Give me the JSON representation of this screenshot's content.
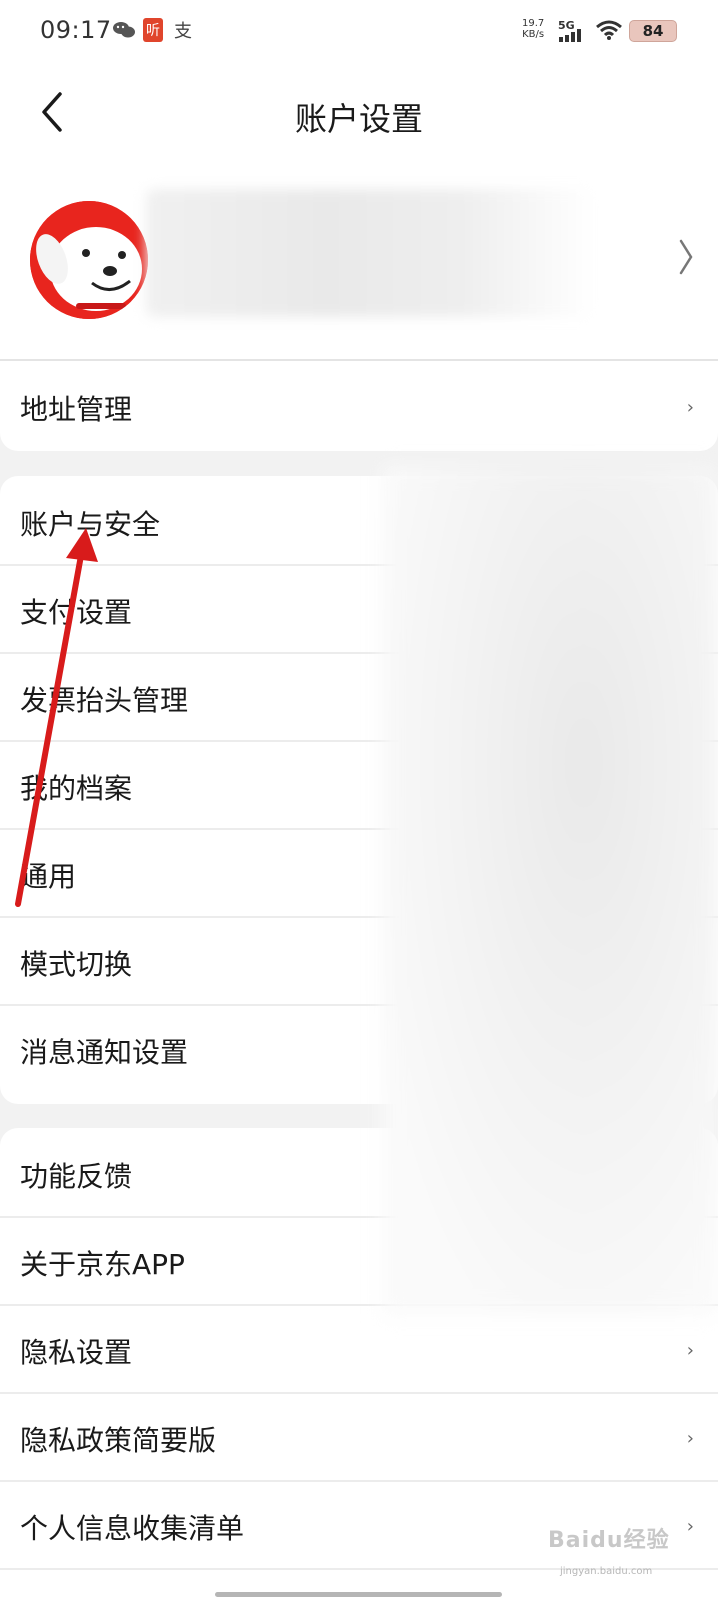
{
  "status_bar": {
    "time": "09:17",
    "wechat_icon": "wechat-icon",
    "app_badge_glyph": "听",
    "alipay_glyph": "支",
    "speed_value": "19.7",
    "speed_unit": "KB/s",
    "network": "5G",
    "battery": "84"
  },
  "header": {
    "title": "账户设置"
  },
  "profile": {
    "avatar": "jd-dog-mascot"
  },
  "groups": [
    {
      "items": [
        {
          "label": "地址管理"
        }
      ]
    },
    {
      "items": [
        {
          "label": "账户与安全"
        },
        {
          "label": "支付设置"
        },
        {
          "label": "发票抬头管理"
        },
        {
          "label": "我的档案"
        },
        {
          "label": "通用"
        },
        {
          "label": "模式切换"
        },
        {
          "label": "消息通知设置"
        }
      ]
    },
    {
      "items": [
        {
          "label": "功能反馈"
        },
        {
          "label": "关于京东APP"
        },
        {
          "label": "隐私设置"
        },
        {
          "label": "隐私政策简要版"
        },
        {
          "label": "个人信息收集清单"
        }
      ]
    }
  ],
  "chevron_glyph": "›",
  "watermark": {
    "text": "Baidu经验",
    "sub": "jingyan.baidu.com"
  },
  "colors": {
    "accent_red": "#e8251e",
    "annotation_arrow": "#d81b1b"
  }
}
